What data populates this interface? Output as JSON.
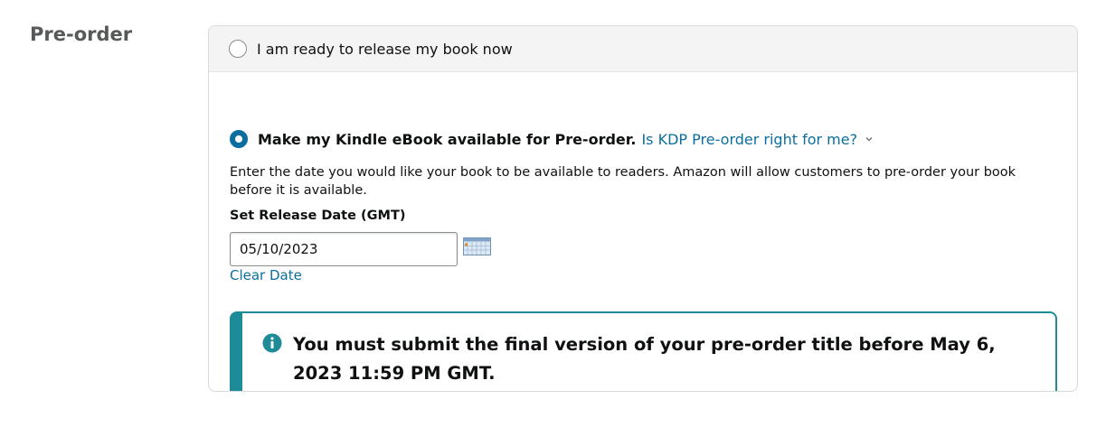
{
  "section": {
    "label": "Pre-order"
  },
  "options": {
    "release_now": {
      "label": "I am ready to release my book now",
      "selected": false
    },
    "preorder": {
      "label": "Make my Kindle eBook available for Pre-order.",
      "help_link": "Is KDP Pre-order right for me?",
      "selected": true
    }
  },
  "preorder_details": {
    "description": "Enter the date you would like your book to be available to readers. Amazon will allow customers to pre-order your book before it is available.",
    "date_label": "Set Release Date (GMT)",
    "date_value": "05/10/2023",
    "clear_label": "Clear Date"
  },
  "alert": {
    "message": "You must submit the final version of your pre-order title before May 6, 2023 11:59 PM GMT."
  },
  "icons": {
    "info": "info-icon",
    "calendar": "calendar-icon",
    "chevron": "chevron-down-icon"
  },
  "colors": {
    "accent": "#0b6e9e",
    "alert_border": "#1e8c98",
    "muted_label": "#565959"
  }
}
